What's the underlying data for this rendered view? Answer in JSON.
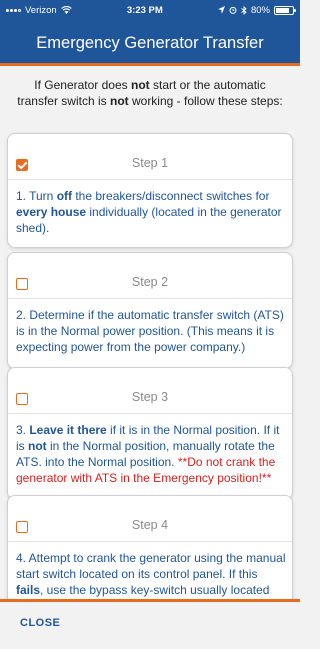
{
  "status_bar": {
    "carrier": "Verizon",
    "time": "3:23 PM",
    "battery": "80%",
    "battery_level": 0.8
  },
  "header": {
    "title": "Emergency Generator Transfer"
  },
  "intro": {
    "p1": "If Generator does ",
    "b1": "not",
    "p2": " start or the automatic transfer switch is ",
    "b2": "not",
    "p3": " working - follow these steps:"
  },
  "steps": [
    {
      "title": "Step 1",
      "checked": true,
      "t1": "1. Turn ",
      "b1": "off",
      "t2": " the breakers/disconnect switches for ",
      "b2": "every house",
      "t3": " individually (located in the generator shed)."
    },
    {
      "title": "Step 2",
      "checked": false,
      "text": "2. Determine if the automatic transfer switch (ATS) is in the Normal power position. (This means it is expecting power from the power company.)"
    },
    {
      "title": "Step 3",
      "checked": false,
      "t1": "3. ",
      "b1": "Leave it there",
      "t2": " if it is in the Normal position. If it is ",
      "b2": "not",
      "t3": " in the Normal position, manually rotate the ATS. into the Normal position. ",
      "red": "**Do not crank the generator with ATS in the Emergency position!**"
    },
    {
      "title": "Step 4",
      "checked": false,
      "t1": "4. Attempt to crank the generator using the manual start switch located on its control panel. If this ",
      "b1": "fails",
      "t2": ", use the bypass key-switch usually located on the side to start the generator. Check the battery if it does not"
    }
  ],
  "footer": {
    "close_label": "CLOSE"
  },
  "colors": {
    "brand_blue": "#1f5599",
    "accent_orange": "#e86b1f",
    "warning_red": "#d9201f"
  }
}
